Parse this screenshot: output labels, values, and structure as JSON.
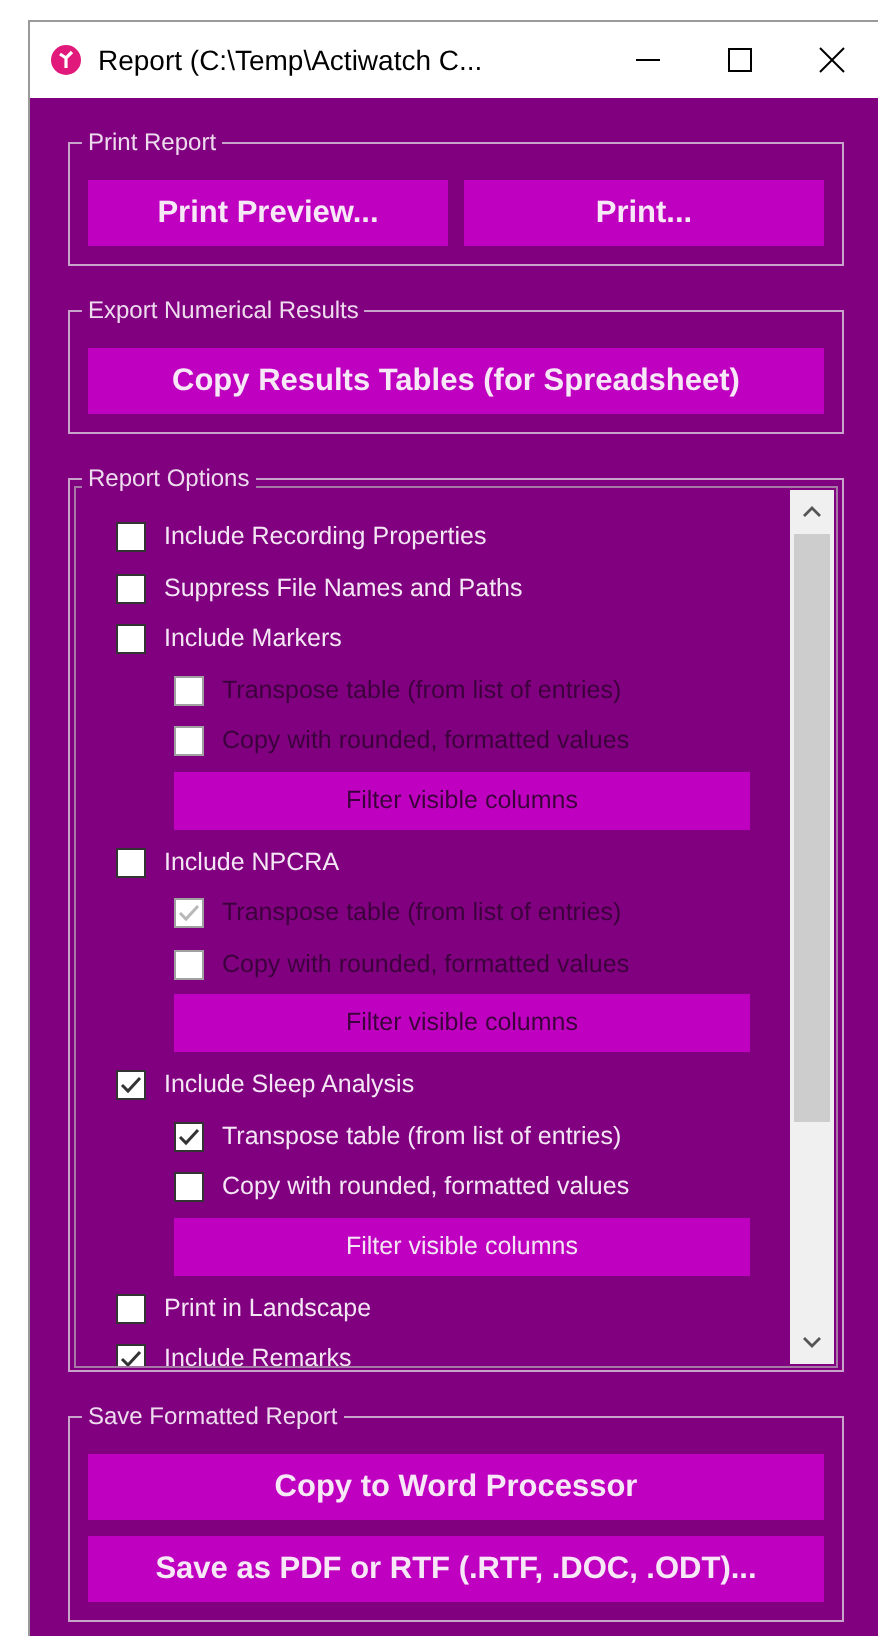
{
  "window": {
    "title": "Report (C:\\Temp\\Actiwatch C..."
  },
  "groups": [
    {
      "kind": "button_row",
      "title": "Print Report",
      "buttons": [
        {
          "label": "Print Preview..."
        },
        {
          "label": "Print..."
        }
      ]
    },
    {
      "kind": "button_row",
      "title": "Export Numerical Results",
      "buttons": [
        {
          "label": "Copy Results Tables (for Spreadsheet)"
        }
      ]
    },
    {
      "kind": "options",
      "title": "Report Options",
      "options": [
        {
          "kind": "check",
          "label": "Include Recording Properties",
          "checked": false
        },
        {
          "kind": "check",
          "label": "Suppress File Names and Paths",
          "checked": false
        },
        {
          "kind": "check",
          "label": "Include Markers",
          "checked": false,
          "children": [
            {
              "kind": "check",
              "label": "Transpose table (from list of entries)",
              "checked": false,
              "disabled": true
            },
            {
              "kind": "check",
              "label": "Copy with rounded, formatted values",
              "checked": false,
              "disabled": true
            },
            {
              "kind": "filter",
              "label": "Filter visible columns",
              "disabled": true
            }
          ]
        },
        {
          "kind": "check",
          "label": "Include NPCRA",
          "checked": false,
          "children": [
            {
              "kind": "check",
              "label": "Transpose table (from list of entries)",
              "checked": true,
              "disabled": true
            },
            {
              "kind": "check",
              "label": "Copy with rounded, formatted values",
              "checked": false,
              "disabled": true
            },
            {
              "kind": "filter",
              "label": "Filter visible columns",
              "disabled": true
            }
          ]
        },
        {
          "kind": "check",
          "label": "Include Sleep Analysis",
          "checked": true,
          "children": [
            {
              "kind": "check",
              "label": "Transpose table (from list of entries)",
              "checked": true,
              "disabled": false
            },
            {
              "kind": "check",
              "label": "Copy with rounded, formatted values",
              "checked": false,
              "disabled": false
            },
            {
              "kind": "filter",
              "label": "Filter visible columns",
              "disabled": false
            }
          ]
        },
        {
          "kind": "check",
          "label": "Print in Landscape",
          "checked": false
        },
        {
          "kind": "check",
          "label": "Include Remarks",
          "checked": true
        }
      ]
    },
    {
      "kind": "button_stack",
      "title": "Save Formatted Report",
      "buttons": [
        {
          "label": "Copy to Word Processor"
        },
        {
          "label": "Save as PDF or RTF (.RTF, .DOC, .ODT)..."
        }
      ]
    }
  ]
}
